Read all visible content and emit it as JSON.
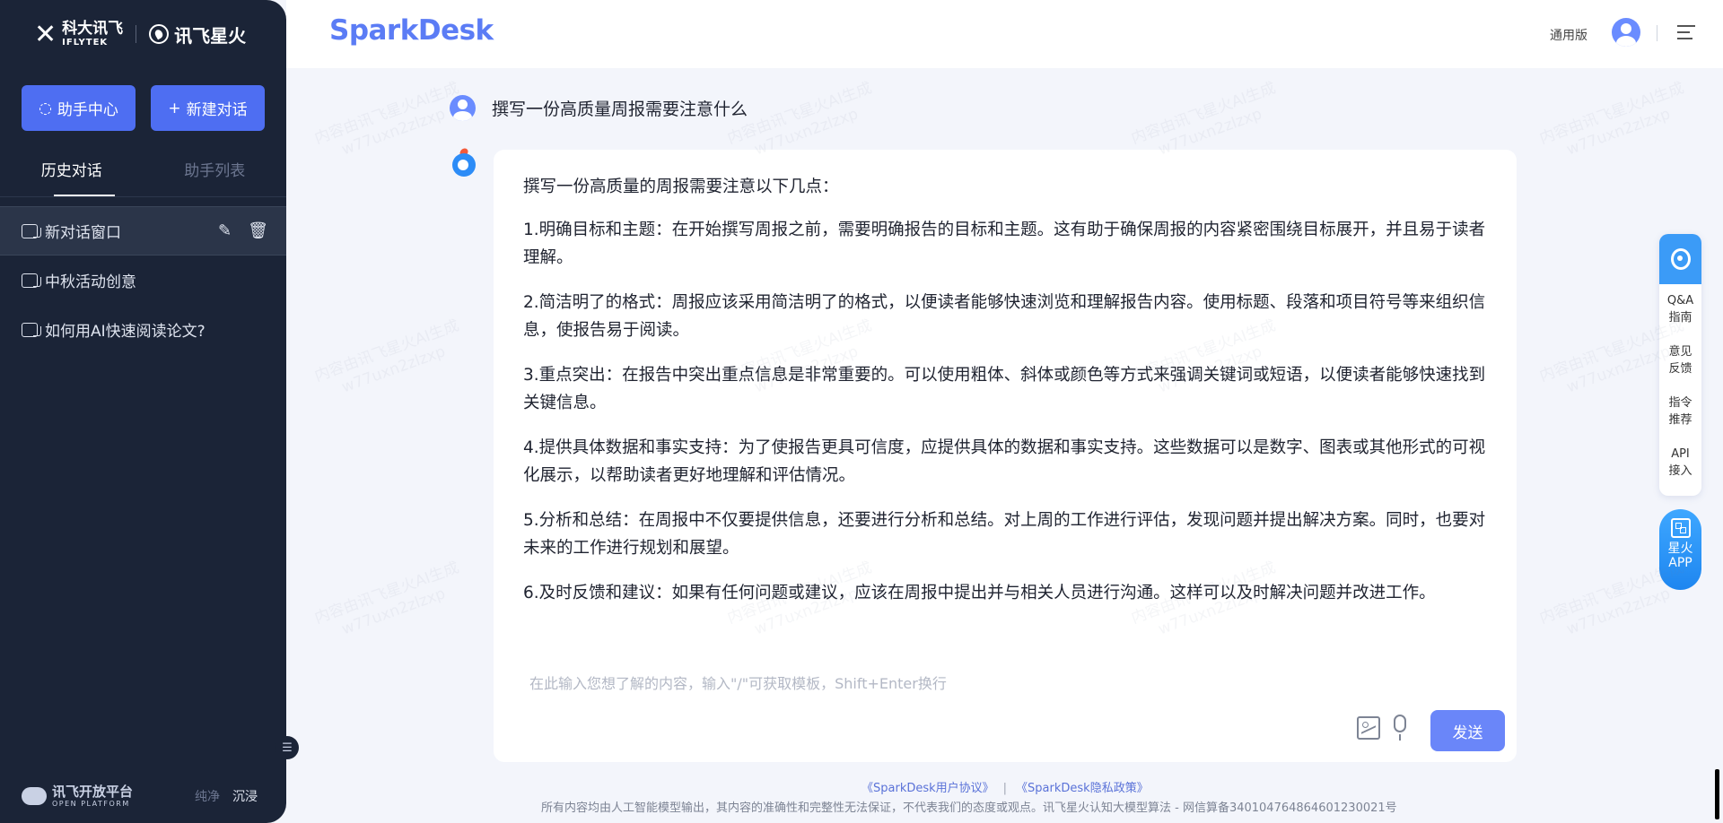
{
  "brand": {
    "logo_a_cn": "科大讯飞",
    "logo_a_en": "IFLYTEK",
    "logo_b_cn": "讯飞星火"
  },
  "sidebar": {
    "assistant_center": "助手中心",
    "new_chat": "新建对话",
    "tabs": [
      {
        "label": "历史对话",
        "active": true
      },
      {
        "label": "助手列表",
        "active": false
      }
    ],
    "conversations": [
      {
        "label": "新对话窗口",
        "active": true
      },
      {
        "label": "中秋活动创意",
        "active": false
      },
      {
        "label": "如何用AI快速阅读论文?",
        "active": false
      }
    ],
    "footer_logo_cn": "讯飞开放平台",
    "footer_logo_en": "OPEN PLATFORM",
    "mode_plain": "纯净",
    "mode_immersive": "沉浸"
  },
  "header": {
    "app_name": "SparkDesk",
    "edition": "通用版"
  },
  "chat": {
    "user_message": "撰写一份高质量周报需要注意什么",
    "answer_paragraphs": [
      "撰写一份高质量的周报需要注意以下几点：",
      "1.明确目标和主题：在开始撰写周报之前，需要明确报告的目标和主题。这有助于确保周报的内容紧密围绕目标展开，并且易于读者理解。",
      "2.简洁明了的格式：周报应该采用简洁明了的格式，以便读者能够快速浏览和理解报告内容。使用标题、段落和项目符号等来组织信息，使报告易于阅读。",
      "3.重点突出：在报告中突出重点信息是非常重要的。可以使用粗体、斜体或颜色等方式来强调关键词或短语，以便读者能够快速找到关键信息。",
      "4.提供具体数据和事实支持：为了使报告更具可信度，应提供具体的数据和事实支持。这些数据可以是数字、图表或其他形式的可视化展示，以帮助读者更好地理解和评估情况。",
      "5.分析和总结：在周报中不仅要提供信息，还要进行分析和总结。对上周的工作进行评估，发现问题并提出解决方案。同时，也要对未来的工作进行规划和展望。",
      "6.及时反馈和建议：如果有任何问题或建议，应该在周报中提出并与相关人员进行沟通。这样可以及时解决问题并改进工作。"
    ],
    "input_placeholder": "在此输入您想了解的内容，输入\"/\"可获取模板，Shift+Enter换行",
    "send_label": "发送"
  },
  "footer": {
    "user_agreement": "《SparkDesk用户协议》",
    "separator": "|",
    "privacy_policy": "《SparkDesk隐私政策》",
    "disclaimer": "所有内容均由人工智能模型输出，其内容的准确性和完整性无法保证，不代表我们的态度或观点。讯飞星火认知大模型算法 - 网信算备340104764864601230021号"
  },
  "float_panel": {
    "items": [
      {
        "line1": "Q&A",
        "line2": "指南"
      },
      {
        "line1": "意见",
        "line2": "反馈"
      },
      {
        "line1": "指令",
        "line2": "推荐"
      },
      {
        "line1": "API",
        "line2": "接入"
      }
    ],
    "app_line1": "星火",
    "app_line2": "APP"
  },
  "watermark": {
    "line1": "内容由讯飞星火AI生成",
    "line2": "w77uxn2zlzxp"
  },
  "colors": {
    "sidebar_bg": "#1b2437",
    "accent": "#4e6ef2",
    "send_button": "#6a86f9",
    "page_bg": "#f3f5fb"
  }
}
